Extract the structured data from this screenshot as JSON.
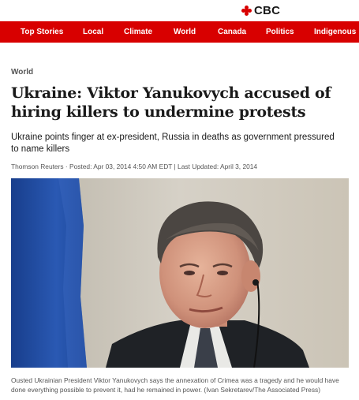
{
  "brand": {
    "name": "CBC"
  },
  "nav": {
    "items": [
      "Top Stories",
      "Local",
      "Climate",
      "World",
      "Canada",
      "Politics",
      "Indigenous"
    ]
  },
  "article": {
    "section": "World",
    "headline": "Ukraine: Viktor Yanukovych accused of hiring killers to undermine protests",
    "deck": "Ukraine points finger at ex-president, Russia in deaths as government pressured to name killers",
    "byline": "Thomson Reuters · Posted: Apr 03, 2014 4:50 AM EDT | Last Updated: April 3, 2014",
    "caption": "Ousted Ukrainian President Viktor Yanukovych says the annexation of Crimea was a tragedy and he would have done everything possible to prevent it, had he remained in power. (Ivan Sekretarev/The Associated Press)"
  },
  "colors": {
    "brand_red": "#d80000",
    "flag_blue": "#1f4fa8"
  }
}
